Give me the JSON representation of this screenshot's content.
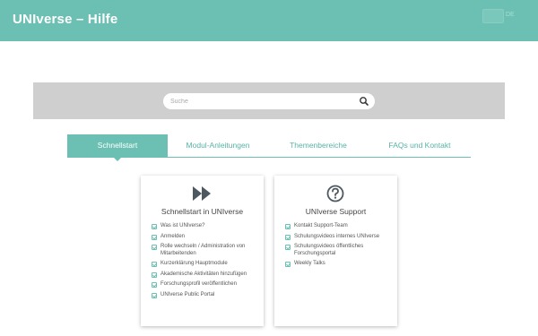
{
  "header": {
    "title": "UNIverse – Hilfe",
    "language": "DE"
  },
  "search": {
    "placeholder": "Suche"
  },
  "tabs": [
    {
      "label": "Schnellstart",
      "active": true
    },
    {
      "label": "Modul-Anleitungen",
      "active": false
    },
    {
      "label": "Themenbereiche",
      "active": false
    },
    {
      "label": "FAQs und Kontakt",
      "active": false
    }
  ],
  "cards": [
    {
      "icon": "fast-forward-icon",
      "title": "Schnellstart in UNIverse",
      "items": [
        "Was ist UNIverse?",
        "Anmelden",
        "Rolle wechseln / Administration von Mitarbeitenden",
        "Kurzerklärung Hauptmodule",
        "Akademische Aktivitäten hinzufügen",
        "Forschungsprofil veröffentlichen",
        "UNIverse Public Portal"
      ]
    },
    {
      "icon": "question-circle-icon",
      "title": "UNIverse Support",
      "items": [
        "Kontakt Support-Team",
        "Schulungsvideos internes UNIverse",
        "Schulungsvideos öffentliches Forschungsportal",
        "Weekly Talks"
      ]
    }
  ],
  "colors": {
    "accent": "#6cc0b3",
    "band": "#cfcfcf"
  }
}
